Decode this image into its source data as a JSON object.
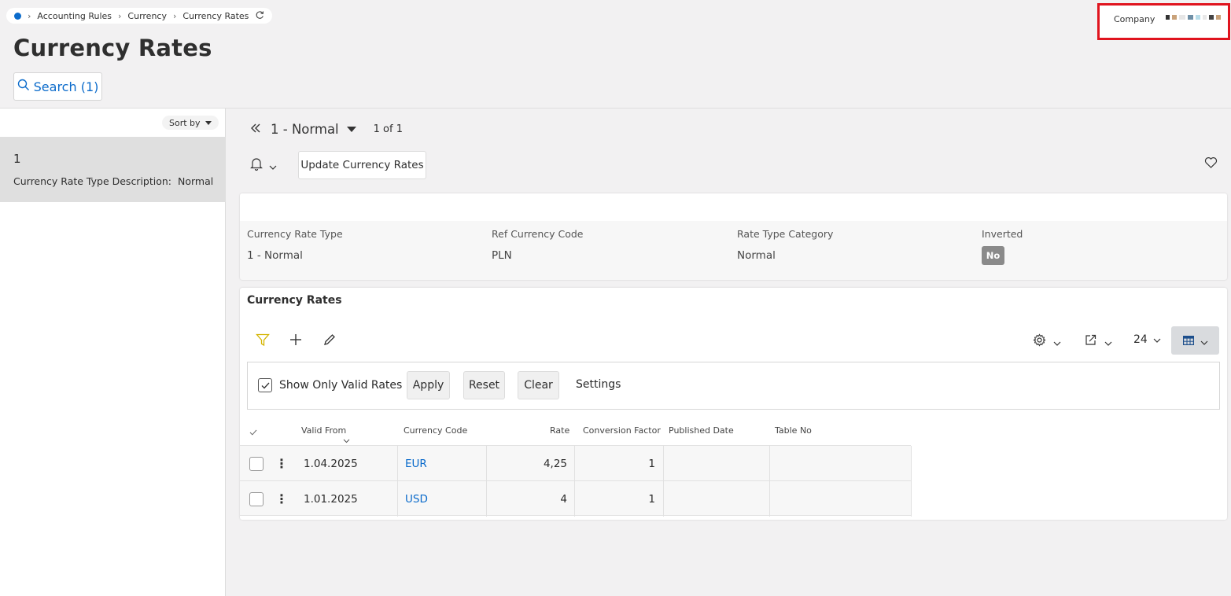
{
  "breadcrumb": {
    "items": [
      "Accounting Rules",
      "Currency",
      "Currency Rates"
    ]
  },
  "company": {
    "label": "Company"
  },
  "page": {
    "title": "Currency Rates",
    "search_label": "Search (1)"
  },
  "list": {
    "sort_label": "Sort by",
    "items": [
      {
        "number": "1",
        "desc_label": "Currency Rate Type Description:",
        "desc_value": "Normal"
      }
    ]
  },
  "record_nav": {
    "title": "1 - Normal",
    "count": "1 of 1"
  },
  "actions": {
    "update_label": "Update Currency Rates"
  },
  "header": {
    "fields": [
      {
        "label": "Currency Rate Type",
        "value": "1 - Normal"
      },
      {
        "label": "Ref Currency Code",
        "value": "PLN"
      },
      {
        "label": "Rate Type Category",
        "value": "Normal"
      },
      {
        "label": "Inverted",
        "value": "No"
      }
    ]
  },
  "rates": {
    "title": "Currency Rates",
    "page_size": "24",
    "filter": {
      "checkbox_label": "Show Only Valid Rates",
      "checked": true,
      "apply_label": "Apply",
      "reset_label": "Reset",
      "clear_label": "Clear",
      "settings_label": "Settings"
    },
    "columns": [
      "Valid From",
      "Currency Code",
      "Rate",
      "Conversion Factor",
      "Published Date",
      "Table No"
    ],
    "rows": [
      {
        "valid_from": "1.04.2025",
        "currency_code": "EUR",
        "rate": "4,25",
        "conversion_factor": "1",
        "published_date": "",
        "table_no": ""
      },
      {
        "valid_from": "1.01.2025",
        "currency_code": "USD",
        "rate": "4",
        "conversion_factor": "1",
        "published_date": "",
        "table_no": ""
      }
    ]
  },
  "colors": {
    "accent": "#0b6bcb",
    "highlight_border": "#e0141e",
    "filter_icon": "#d4b400"
  }
}
